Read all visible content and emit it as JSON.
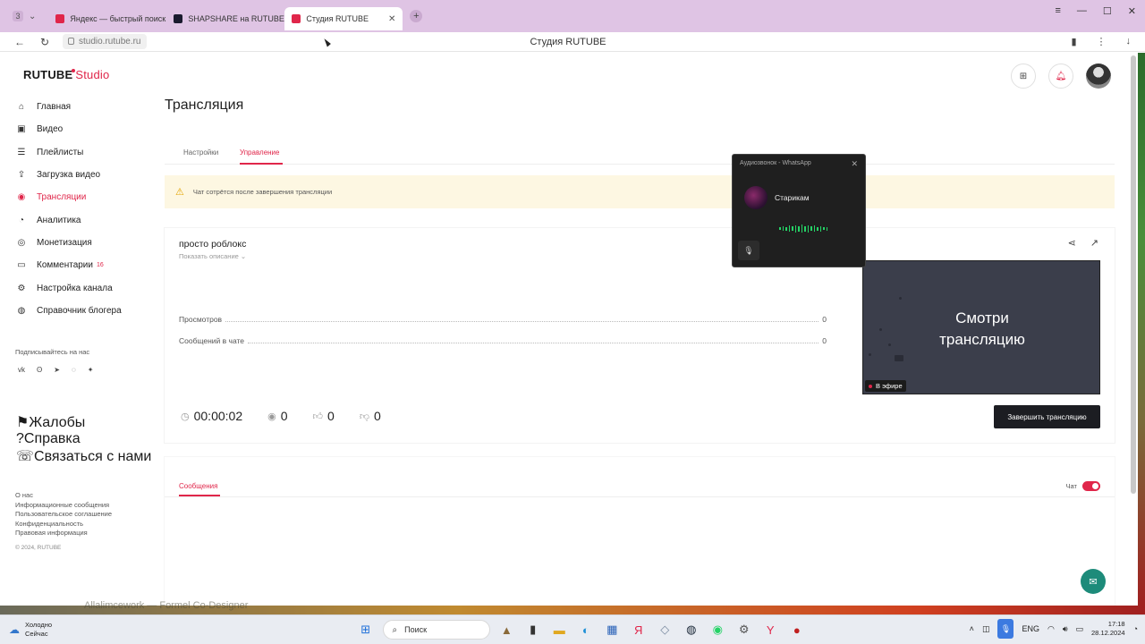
{
  "browser": {
    "tab_counter": "3",
    "tabs": [
      {
        "label": "Яндекс — быстрый поиск",
        "favicon_color": "#e0264a"
      },
      {
        "label": "SHAPSHARE на RUTUBE",
        "favicon_color": "#1a1a2e"
      },
      {
        "label": "Студия RUTUBE",
        "favicon_color": "#e0264a"
      }
    ],
    "url": "studio.rutube.ru",
    "page_title": "Студия RUTUBE"
  },
  "logo": {
    "brand": "RUTUBE",
    "studio": "Studio"
  },
  "sidebar": {
    "items": [
      {
        "label": "Главная",
        "icon": "home-icon",
        "glyph": "⌂"
      },
      {
        "label": "Видео",
        "icon": "video-icon",
        "glyph": "▣"
      },
      {
        "label": "Плейлисты",
        "icon": "playlist-icon",
        "glyph": "☰"
      },
      {
        "label": "Загрузка видео",
        "icon": "upload-icon",
        "glyph": "⇪"
      },
      {
        "label": "Трансляции",
        "icon": "broadcast-icon",
        "glyph": "◉",
        "active": true
      },
      {
        "label": "Аналитика",
        "icon": "analytics-icon",
        "glyph": "◔"
      },
      {
        "label": "Монетизация",
        "icon": "monetization-icon",
        "glyph": "◎"
      },
      {
        "label": "Комментарии",
        "icon": "comments-icon",
        "glyph": "▭",
        "badge": "16"
      },
      {
        "label": "Настройка канала",
        "icon": "settings-icon",
        "glyph": "⚙"
      },
      {
        "label": "Справочник блогера",
        "icon": "handbook-icon",
        "glyph": "◍"
      }
    ],
    "subscribe_label": "Подписывайтесь на нас",
    "socials": [
      "vk-icon",
      "ok-icon",
      "telegram-icon",
      "viber-icon",
      "plus-icon"
    ],
    "secondary": [
      {
        "label": "Жалобы",
        "icon": "flag-icon",
        "glyph": "⚑"
      },
      {
        "label": "Справка",
        "icon": "help-icon",
        "glyph": "?"
      },
      {
        "label": "Связаться с нами",
        "icon": "contact-icon",
        "glyph": "☏"
      }
    ],
    "footer_links": [
      "О нас",
      "Информационные сообщения",
      "Пользовательское соглашение",
      "Конфиденциальность",
      "Правовая информация"
    ],
    "copyright": "© 2024, RUTUBE"
  },
  "main": {
    "title": "Трансляция",
    "tabs": [
      "Настройки",
      "Управление"
    ],
    "notice": "Чат сотрётся после завершения трансляции",
    "stream": {
      "title": "просто роблокс",
      "show_description": "Показать описание",
      "stats": [
        {
          "label": "Просмотров",
          "value": "0"
        },
        {
          "label": "Сообщений в чате",
          "value": "0"
        }
      ],
      "timer": "00:00:02",
      "viewers": "0",
      "likes": "0",
      "dislikes": "0",
      "preview_text_1": "Смотри",
      "preview_text_2": "трансляцию",
      "live_label": "В эфире",
      "end_button": "Завершить трансляцию"
    },
    "messages_tab": "Сообщения",
    "chat_label": "Чат",
    "chat_enabled": true
  },
  "whatsapp_call": {
    "title": "Аудиозвонок - WhatsApp",
    "contact": "Старикам"
  },
  "taskbar": {
    "weather_1": "Холодно",
    "weather_2": "Сейчас",
    "search": "Поиск",
    "lang": "ENG",
    "time": "17:18",
    "date": "28.12.2024",
    "behind_text": "Allalimcework — Formel Co-Designer"
  },
  "colors": {
    "accent": "#e0264a",
    "dark": "#1c1d22",
    "whatsapp": "#25d366"
  }
}
